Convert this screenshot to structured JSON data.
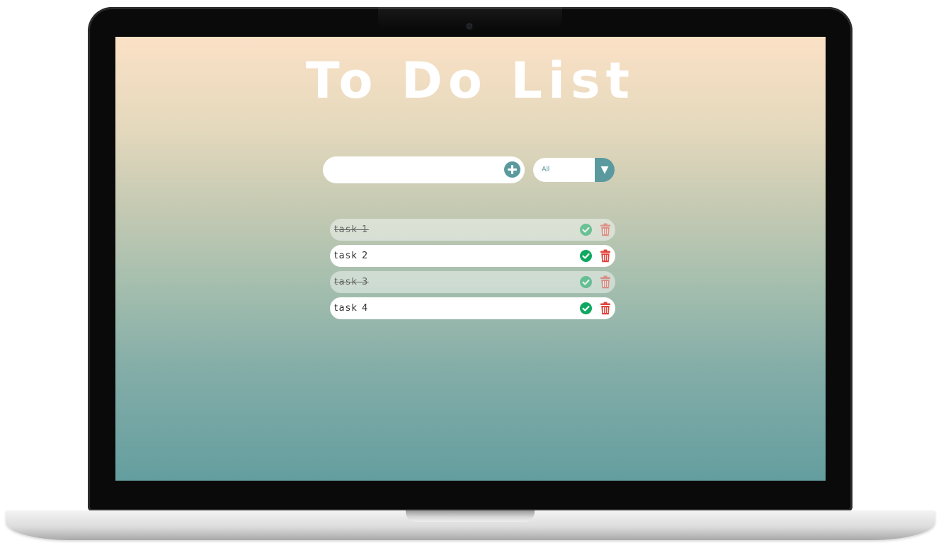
{
  "app": {
    "title": "To Do List"
  },
  "add_form": {
    "input_value": "",
    "input_placeholder": "",
    "add_icon": "plus-circle-icon"
  },
  "filter": {
    "selected": "All",
    "arrow_icon": "triangle-down-icon"
  },
  "todos": [
    {
      "label": "task 1",
      "completed": true
    },
    {
      "label": "task 2",
      "completed": false
    },
    {
      "label": "task 3",
      "completed": true
    },
    {
      "label": "task 4",
      "completed": false
    }
  ],
  "item_icons": {
    "complete": "check-circle-icon",
    "delete": "trash-icon"
  },
  "colors": {
    "gradient_top": "#fbe1c6",
    "gradient_bottom": "#649e9f",
    "accent": "#5a9a9e",
    "check": "#0fa860",
    "trash": "#e2453c"
  }
}
